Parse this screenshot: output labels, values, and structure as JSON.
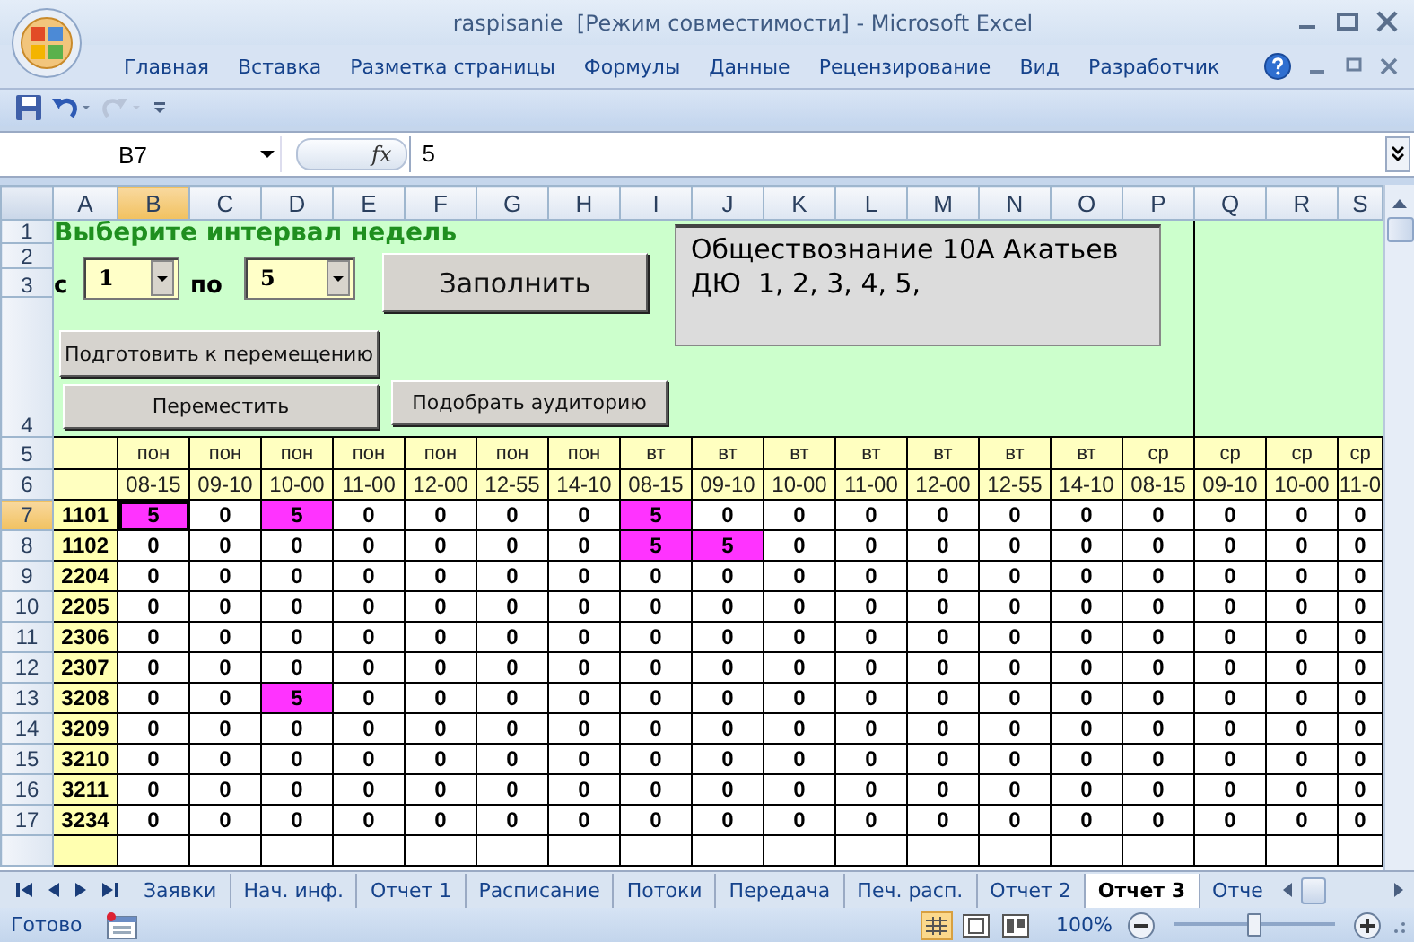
{
  "window": {
    "title": "raspisanie  [Режим совместимости] - Microsoft Excel"
  },
  "ribbon_tabs": [
    "Главная",
    "Вставка",
    "Разметка страницы",
    "Формулы",
    "Данные",
    "Рецензирование",
    "Вид",
    "Разработчик"
  ],
  "name_box": "B7",
  "function_label": "fx",
  "formula": "5",
  "columns": [
    {
      "label": "A",
      "selected": false
    },
    {
      "label": "B",
      "selected": true
    },
    {
      "label": "C",
      "selected": false
    },
    {
      "label": "D",
      "selected": false
    },
    {
      "label": "E",
      "selected": false
    },
    {
      "label": "F",
      "selected": false
    },
    {
      "label": "G",
      "selected": false
    },
    {
      "label": "H",
      "selected": false
    },
    {
      "label": "I",
      "selected": false
    },
    {
      "label": "J",
      "selected": false
    },
    {
      "label": "K",
      "selected": false
    },
    {
      "label": "L",
      "selected": false
    },
    {
      "label": "M",
      "selected": false
    },
    {
      "label": "N",
      "selected": false
    },
    {
      "label": "O",
      "selected": false
    },
    {
      "label": "P",
      "selected": false
    },
    {
      "label": "Q",
      "selected": false
    },
    {
      "label": "R",
      "selected": false
    },
    {
      "label": "S",
      "selected": false
    }
  ],
  "form": {
    "prompt": "Выберите интервал недель",
    "from_label": "с",
    "from_value": "1",
    "to_label": "по",
    "to_value": "5",
    "fill_button": "Заполнить",
    "info_lines": [
      "Обществознание 10А Акатьев",
      "ДЮ  1, 2, 3, 4, 5,"
    ],
    "prepare_button": "Подготовить к перемещению",
    "move_button": "Переместить",
    "room_button": "Подобрать аудиторию"
  },
  "top_row_headers": [
    "1",
    "2",
    "3",
    "4"
  ],
  "day_row": {
    "header": "5",
    "cells": [
      "пон",
      "пон",
      "пон",
      "пон",
      "пон",
      "пон",
      "пон",
      "вт",
      "вт",
      "вт",
      "вт",
      "вт",
      "вт",
      "вт",
      "ср",
      "ср",
      "ср",
      "ср"
    ]
  },
  "time_row": {
    "header": "6",
    "cells": [
      "08-15",
      "09-10",
      "10-00",
      "11-00",
      "12-00",
      "12-55",
      "14-10",
      "08-15",
      "09-10",
      "10-00",
      "11-00",
      "12-00",
      "12-55",
      "14-10",
      "08-15",
      "09-10",
      "10-00",
      "11-0"
    ]
  },
  "rows": [
    {
      "header": "7",
      "selected": true,
      "room": "1101",
      "cells": [
        {
          "value": "5",
          "marked": true
        },
        {
          "value": "0",
          "marked": false
        },
        {
          "value": "5",
          "marked": true
        },
        {
          "value": "0",
          "marked": false
        },
        {
          "value": "0",
          "marked": false
        },
        {
          "value": "0",
          "marked": false
        },
        {
          "value": "0",
          "marked": false
        },
        {
          "value": "5",
          "marked": true
        },
        {
          "value": "0",
          "marked": false
        },
        {
          "value": "0",
          "marked": false
        },
        {
          "value": "0",
          "marked": false
        },
        {
          "value": "0",
          "marked": false
        },
        {
          "value": "0",
          "marked": false
        },
        {
          "value": "0",
          "marked": false
        },
        {
          "value": "0",
          "marked": false
        },
        {
          "value": "0",
          "marked": false
        },
        {
          "value": "0",
          "marked": false
        },
        {
          "value": "0",
          "marked": false
        }
      ]
    },
    {
      "header": "8",
      "selected": false,
      "room": "1102",
      "cells": [
        {
          "value": "0",
          "marked": false
        },
        {
          "value": "0",
          "marked": false
        },
        {
          "value": "0",
          "marked": false
        },
        {
          "value": "0",
          "marked": false
        },
        {
          "value": "0",
          "marked": false
        },
        {
          "value": "0",
          "marked": false
        },
        {
          "value": "0",
          "marked": false
        },
        {
          "value": "5",
          "marked": true
        },
        {
          "value": "5",
          "marked": true
        },
        {
          "value": "0",
          "marked": false
        },
        {
          "value": "0",
          "marked": false
        },
        {
          "value": "0",
          "marked": false
        },
        {
          "value": "0",
          "marked": false
        },
        {
          "value": "0",
          "marked": false
        },
        {
          "value": "0",
          "marked": false
        },
        {
          "value": "0",
          "marked": false
        },
        {
          "value": "0",
          "marked": false
        },
        {
          "value": "0",
          "marked": false
        }
      ]
    },
    {
      "header": "9",
      "selected": false,
      "room": "2204",
      "cells": [
        {
          "value": "0",
          "marked": false
        },
        {
          "value": "0",
          "marked": false
        },
        {
          "value": "0",
          "marked": false
        },
        {
          "value": "0",
          "marked": false
        },
        {
          "value": "0",
          "marked": false
        },
        {
          "value": "0",
          "marked": false
        },
        {
          "value": "0",
          "marked": false
        },
        {
          "value": "0",
          "marked": false
        },
        {
          "value": "0",
          "marked": false
        },
        {
          "value": "0",
          "marked": false
        },
        {
          "value": "0",
          "marked": false
        },
        {
          "value": "0",
          "marked": false
        },
        {
          "value": "0",
          "marked": false
        },
        {
          "value": "0",
          "marked": false
        },
        {
          "value": "0",
          "marked": false
        },
        {
          "value": "0",
          "marked": false
        },
        {
          "value": "0",
          "marked": false
        },
        {
          "value": "0",
          "marked": false
        }
      ]
    },
    {
      "header": "10",
      "selected": false,
      "room": "2205",
      "cells": [
        {
          "value": "0",
          "marked": false
        },
        {
          "value": "0",
          "marked": false
        },
        {
          "value": "0",
          "marked": false
        },
        {
          "value": "0",
          "marked": false
        },
        {
          "value": "0",
          "marked": false
        },
        {
          "value": "0",
          "marked": false
        },
        {
          "value": "0",
          "marked": false
        },
        {
          "value": "0",
          "marked": false
        },
        {
          "value": "0",
          "marked": false
        },
        {
          "value": "0",
          "marked": false
        },
        {
          "value": "0",
          "marked": false
        },
        {
          "value": "0",
          "marked": false
        },
        {
          "value": "0",
          "marked": false
        },
        {
          "value": "0",
          "marked": false
        },
        {
          "value": "0",
          "marked": false
        },
        {
          "value": "0",
          "marked": false
        },
        {
          "value": "0",
          "marked": false
        },
        {
          "value": "0",
          "marked": false
        }
      ]
    },
    {
      "header": "11",
      "selected": false,
      "room": "2306",
      "cells": [
        {
          "value": "0",
          "marked": false
        },
        {
          "value": "0",
          "marked": false
        },
        {
          "value": "0",
          "marked": false
        },
        {
          "value": "0",
          "marked": false
        },
        {
          "value": "0",
          "marked": false
        },
        {
          "value": "0",
          "marked": false
        },
        {
          "value": "0",
          "marked": false
        },
        {
          "value": "0",
          "marked": false
        },
        {
          "value": "0",
          "marked": false
        },
        {
          "value": "0",
          "marked": false
        },
        {
          "value": "0",
          "marked": false
        },
        {
          "value": "0",
          "marked": false
        },
        {
          "value": "0",
          "marked": false
        },
        {
          "value": "0",
          "marked": false
        },
        {
          "value": "0",
          "marked": false
        },
        {
          "value": "0",
          "marked": false
        },
        {
          "value": "0",
          "marked": false
        },
        {
          "value": "0",
          "marked": false
        }
      ]
    },
    {
      "header": "12",
      "selected": false,
      "room": "2307",
      "cells": [
        {
          "value": "0",
          "marked": false
        },
        {
          "value": "0",
          "marked": false
        },
        {
          "value": "0",
          "marked": false
        },
        {
          "value": "0",
          "marked": false
        },
        {
          "value": "0",
          "marked": false
        },
        {
          "value": "0",
          "marked": false
        },
        {
          "value": "0",
          "marked": false
        },
        {
          "value": "0",
          "marked": false
        },
        {
          "value": "0",
          "marked": false
        },
        {
          "value": "0",
          "marked": false
        },
        {
          "value": "0",
          "marked": false
        },
        {
          "value": "0",
          "marked": false
        },
        {
          "value": "0",
          "marked": false
        },
        {
          "value": "0",
          "marked": false
        },
        {
          "value": "0",
          "marked": false
        },
        {
          "value": "0",
          "marked": false
        },
        {
          "value": "0",
          "marked": false
        },
        {
          "value": "0",
          "marked": false
        }
      ]
    },
    {
      "header": "13",
      "selected": false,
      "room": "3208",
      "cells": [
        {
          "value": "0",
          "marked": false
        },
        {
          "value": "0",
          "marked": false
        },
        {
          "value": "5",
          "marked": true
        },
        {
          "value": "0",
          "marked": false
        },
        {
          "value": "0",
          "marked": false
        },
        {
          "value": "0",
          "marked": false
        },
        {
          "value": "0",
          "marked": false
        },
        {
          "value": "0",
          "marked": false
        },
        {
          "value": "0",
          "marked": false
        },
        {
          "value": "0",
          "marked": false
        },
        {
          "value": "0",
          "marked": false
        },
        {
          "value": "0",
          "marked": false
        },
        {
          "value": "0",
          "marked": false
        },
        {
          "value": "0",
          "marked": false
        },
        {
          "value": "0",
          "marked": false
        },
        {
          "value": "0",
          "marked": false
        },
        {
          "value": "0",
          "marked": false
        },
        {
          "value": "0",
          "marked": false
        }
      ]
    },
    {
      "header": "14",
      "selected": false,
      "room": "3209",
      "cells": [
        {
          "value": "0",
          "marked": false
        },
        {
          "value": "0",
          "marked": false
        },
        {
          "value": "0",
          "marked": false
        },
        {
          "value": "0",
          "marked": false
        },
        {
          "value": "0",
          "marked": false
        },
        {
          "value": "0",
          "marked": false
        },
        {
          "value": "0",
          "marked": false
        },
        {
          "value": "0",
          "marked": false
        },
        {
          "value": "0",
          "marked": false
        },
        {
          "value": "0",
          "marked": false
        },
        {
          "value": "0",
          "marked": false
        },
        {
          "value": "0",
          "marked": false
        },
        {
          "value": "0",
          "marked": false
        },
        {
          "value": "0",
          "marked": false
        },
        {
          "value": "0",
          "marked": false
        },
        {
          "value": "0",
          "marked": false
        },
        {
          "value": "0",
          "marked": false
        },
        {
          "value": "0",
          "marked": false
        }
      ]
    },
    {
      "header": "15",
      "selected": false,
      "room": "3210",
      "cells": [
        {
          "value": "0",
          "marked": false
        },
        {
          "value": "0",
          "marked": false
        },
        {
          "value": "0",
          "marked": false
        },
        {
          "value": "0",
          "marked": false
        },
        {
          "value": "0",
          "marked": false
        },
        {
          "value": "0",
          "marked": false
        },
        {
          "value": "0",
          "marked": false
        },
        {
          "value": "0",
          "marked": false
        },
        {
          "value": "0",
          "marked": false
        },
        {
          "value": "0",
          "marked": false
        },
        {
          "value": "0",
          "marked": false
        },
        {
          "value": "0",
          "marked": false
        },
        {
          "value": "0",
          "marked": false
        },
        {
          "value": "0",
          "marked": false
        },
        {
          "value": "0",
          "marked": false
        },
        {
          "value": "0",
          "marked": false
        },
        {
          "value": "0",
          "marked": false
        },
        {
          "value": "0",
          "marked": false
        }
      ]
    },
    {
      "header": "16",
      "selected": false,
      "room": "3211",
      "cells": [
        {
          "value": "0",
          "marked": false
        },
        {
          "value": "0",
          "marked": false
        },
        {
          "value": "0",
          "marked": false
        },
        {
          "value": "0",
          "marked": false
        },
        {
          "value": "0",
          "marked": false
        },
        {
          "value": "0",
          "marked": false
        },
        {
          "value": "0",
          "marked": false
        },
        {
          "value": "0",
          "marked": false
        },
        {
          "value": "0",
          "marked": false
        },
        {
          "value": "0",
          "marked": false
        },
        {
          "value": "0",
          "marked": false
        },
        {
          "value": "0",
          "marked": false
        },
        {
          "value": "0",
          "marked": false
        },
        {
          "value": "0",
          "marked": false
        },
        {
          "value": "0",
          "marked": false
        },
        {
          "value": "0",
          "marked": false
        },
        {
          "value": "0",
          "marked": false
        },
        {
          "value": "0",
          "marked": false
        }
      ]
    },
    {
      "header": "17",
      "selected": false,
      "room": "3234",
      "cells": [
        {
          "value": "0",
          "marked": false
        },
        {
          "value": "0",
          "marked": false
        },
        {
          "value": "0",
          "marked": false
        },
        {
          "value": "0",
          "marked": false
        },
        {
          "value": "0",
          "marked": false
        },
        {
          "value": "0",
          "marked": false
        },
        {
          "value": "0",
          "marked": false
        },
        {
          "value": "0",
          "marked": false
        },
        {
          "value": "0",
          "marked": false
        },
        {
          "value": "0",
          "marked": false
        },
        {
          "value": "0",
          "marked": false
        },
        {
          "value": "0",
          "marked": false
        },
        {
          "value": "0",
          "marked": false
        },
        {
          "value": "0",
          "marked": false
        },
        {
          "value": "0",
          "marked": false
        },
        {
          "value": "0",
          "marked": false
        },
        {
          "value": "0",
          "marked": false
        },
        {
          "value": "0",
          "marked": false
        }
      ]
    }
  ],
  "sheet_tabs": [
    {
      "label": "Заявки",
      "selected": false
    },
    {
      "label": "Нач. инф.",
      "selected": false
    },
    {
      "label": "Отчет 1",
      "selected": false
    },
    {
      "label": "Расписание",
      "selected": false
    },
    {
      "label": "Потоки",
      "selected": false
    },
    {
      "label": "Передача",
      "selected": false
    },
    {
      "label": "Печ. расп.",
      "selected": false
    },
    {
      "label": "Отчет 2",
      "selected": false
    },
    {
      "label": "Отчет 3",
      "selected": true
    },
    {
      "label": "Отче",
      "selected": false
    }
  ],
  "status_bar": {
    "text": "Готово",
    "zoom": "100%",
    "zoom_slider": {
      "level": 0.5
    }
  }
}
